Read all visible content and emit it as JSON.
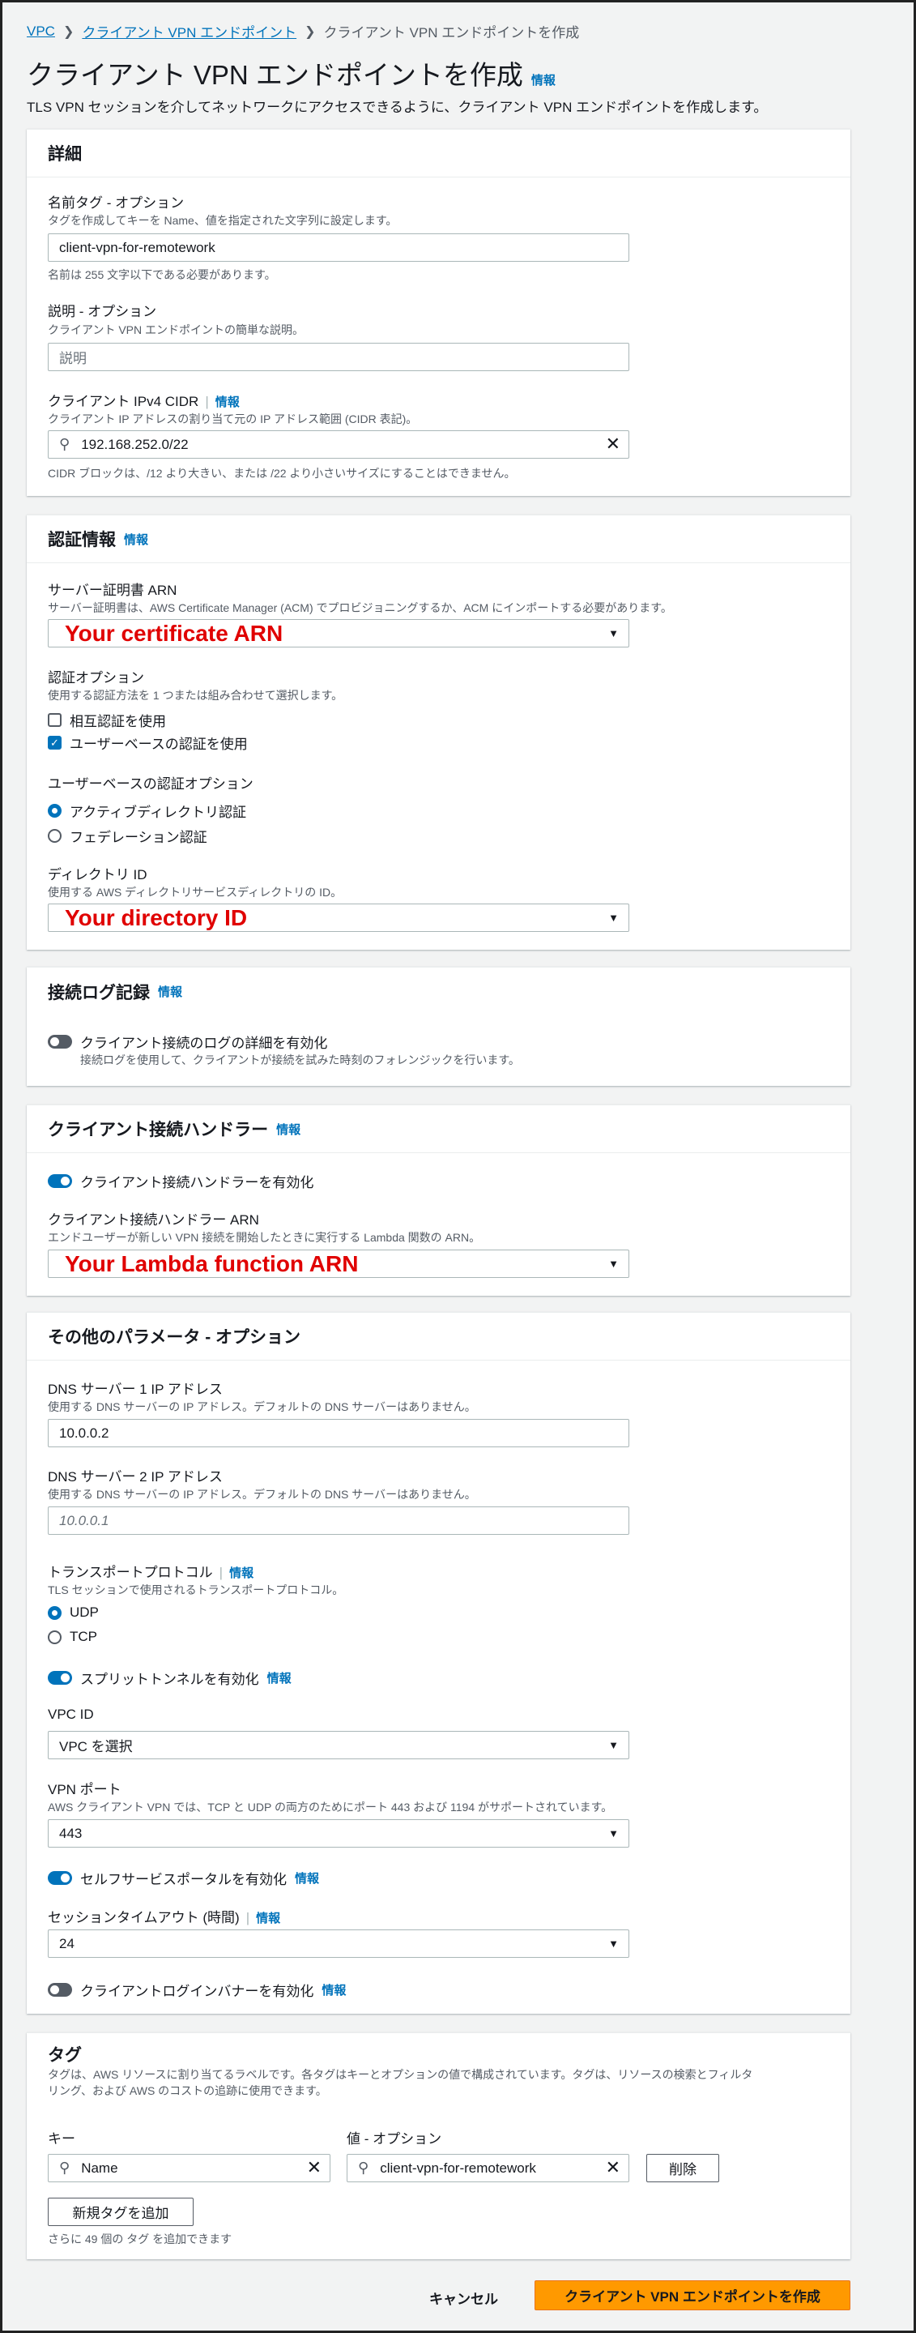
{
  "breadcrumb": {
    "vpc": "VPC",
    "endpoints": "クライアント VPN エンドポイント",
    "current": "クライアント VPN エンドポイントを作成"
  },
  "page": {
    "title": "クライアント VPN エンドポイントを作成",
    "info": "情報",
    "description": "TLS VPN セッションを介してネットワークにアクセスできるように、クライアント VPN エンドポイントを作成します。"
  },
  "details": {
    "heading": "詳細",
    "name_label": "名前タグ - オプション",
    "name_desc": "タグを作成してキーを Name、値を指定された文字列に設定します。",
    "name_value": "client-vpn-for-remotework",
    "name_hint": "名前は 255 文字以下である必要があります。",
    "desc_label": "説明 - オプション",
    "desc_desc": "クライアント VPN エンドポイントの簡単な説明。",
    "desc_placeholder": "説明",
    "cidr_label": "クライアント IPv4 CIDR",
    "cidr_info": "情報",
    "cidr_desc": "クライアント IP アドレスの割り当て元の IP アドレス範囲 (CIDR 表記)。",
    "cidr_value": "192.168.252.0/22",
    "cidr_hint": "CIDR ブロックは、/12 より大きい、または /22 より小さいサイズにすることはできません。"
  },
  "auth": {
    "heading": "認証情報",
    "info": "情報",
    "cert_label": "サーバー証明書 ARN",
    "cert_desc": "サーバー証明書は、AWS Certificate Manager (ACM) でプロビジョニングするか、ACM にインポートする必要があります。",
    "cert_value": "Your certificate ARN",
    "opt_label": "認証オプション",
    "opt_desc": "使用する認証方法を 1 つまたは組み合わせて選択します。",
    "mutual": "相互認証を使用",
    "user_based": "ユーザーベースの認証を使用",
    "ub_label": "ユーザーベースの認証オプション",
    "ad": "アクティブディレクトリ認証",
    "fed": "フェデレーション認証",
    "dir_label": "ディレクトリ ID",
    "dir_desc": "使用する AWS ディレクトリサービスディレクトリの ID。",
    "dir_value": "Your directory ID"
  },
  "conn_log": {
    "heading": "接続ログ記録",
    "info": "情報",
    "toggle": "クライアント接続のログの詳細を有効化",
    "toggle_desc": "接続ログを使用して、クライアントが接続を試みた時刻のフォレンジックを行います。"
  },
  "handler": {
    "heading": "クライアント接続ハンドラー",
    "info": "情報",
    "toggle": "クライアント接続ハンドラーを有効化",
    "arn_label": "クライアント接続ハンドラー ARN",
    "arn_desc": "エンドユーザーが新しい VPN 接続を開始したときに実行する Lambda 関数の ARN。",
    "arn_value": "Your Lambda function ARN"
  },
  "other": {
    "heading": "その他のパラメータ - オプション",
    "dns1_label": "DNS サーバー 1 IP アドレス",
    "dns1_desc": "使用する DNS サーバーの IP アドレス。デフォルトの DNS サーバーはありません。",
    "dns1_value": "10.0.0.2",
    "dns2_label": "DNS サーバー 2 IP アドレス",
    "dns2_desc": "使用する DNS サーバーの IP アドレス。デフォルトの DNS サーバーはありません。",
    "dns2_placeholder": "10.0.0.1",
    "transport_label": "トランスポートプロトコル",
    "transport_info": "情報",
    "transport_desc": "TLS セッションで使用されるトランスポートプロトコル。",
    "udp": "UDP",
    "tcp": "TCP",
    "split": "スプリットトンネルを有効化",
    "split_info": "情報",
    "vpc_label": "VPC ID",
    "vpc_placeholder": "VPC を選択",
    "port_label": "VPN ポート",
    "port_desc": "AWS クライアント VPN では、TCP と UDP の両方のためにポート 443 および 1194 がサポートされています。",
    "port_value": "443",
    "portal": "セルフサービスポータルを有効化",
    "portal_info": "情報",
    "timeout_label": "セッションタイムアウト (時間)",
    "timeout_info": "情報",
    "timeout_value": "24",
    "banner": "クライアントログインバナーを有効化",
    "banner_info": "情報"
  },
  "tags": {
    "heading": "タグ",
    "desc1": "タグは、AWS リソースに割り当てるラベルです。各タグはキーとオプションの値で構成されています。タグは、リソースの検索とフィルタ",
    "desc2": "リング、および AWS のコストの追跡に使用できます。",
    "key_label": "キー",
    "value_label": "値 - オプション",
    "key_value": "Name",
    "val_value": "client-vpn-for-remotework",
    "remove": "削除",
    "add": "新規タグを追加",
    "hint": "さらに 49 個の タグ を追加できます"
  },
  "footer": {
    "cancel": "キャンセル",
    "create": "クライアント VPN エンドポイントを作成"
  }
}
